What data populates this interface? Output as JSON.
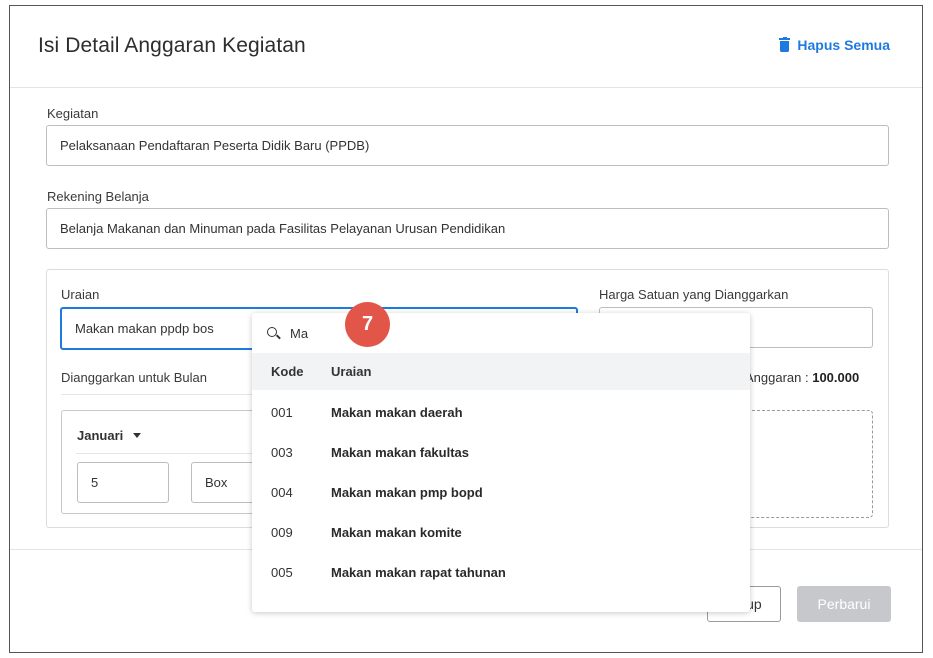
{
  "dialog": {
    "title": "Isi Detail Anggaran Kegiatan",
    "clear_all_label": "Hapus Semua"
  },
  "kegiatan": {
    "label": "Kegiatan",
    "value": "Pelaksanaan Pendaftaran Peserta Didik Baru (PPDB)"
  },
  "rekening": {
    "label": "Rekening Belanja",
    "value": "Belanja Makanan dan Minuman pada Fasilitas Pelayanan Urusan Pendidikan"
  },
  "uraian": {
    "label": "Uraian",
    "value": "Makan makan ppdp bos"
  },
  "harga": {
    "label": "Harga Satuan yang Dianggarkan",
    "value": ""
  },
  "bulan": {
    "label": "Dianggarkan untuk Bulan",
    "selected": "Januari",
    "quantity": "5",
    "unit": "Box"
  },
  "anggaran": {
    "label": "Anggaran : ",
    "value": "100.000"
  },
  "dropdown": {
    "search_value": "Ma",
    "columns": [
      "Kode",
      "Uraian"
    ],
    "rows": [
      {
        "kode": "001",
        "uraian": "Makan makan daerah"
      },
      {
        "kode": "003",
        "uraian": "Makan makan fakultas"
      },
      {
        "kode": "004",
        "uraian": "Makan makan pmp bopd"
      },
      {
        "kode": "009",
        "uraian": "Makan makan komite"
      },
      {
        "kode": "005",
        "uraian": "Makan makan rapat tahunan"
      }
    ]
  },
  "step_badge": "7",
  "footer": {
    "close_label": "Tutup",
    "update_label": "Perbarui"
  },
  "colors": {
    "accent": "#1f7ae0",
    "badge": "#e2564a",
    "disabled_button": "#c6c8cc"
  }
}
